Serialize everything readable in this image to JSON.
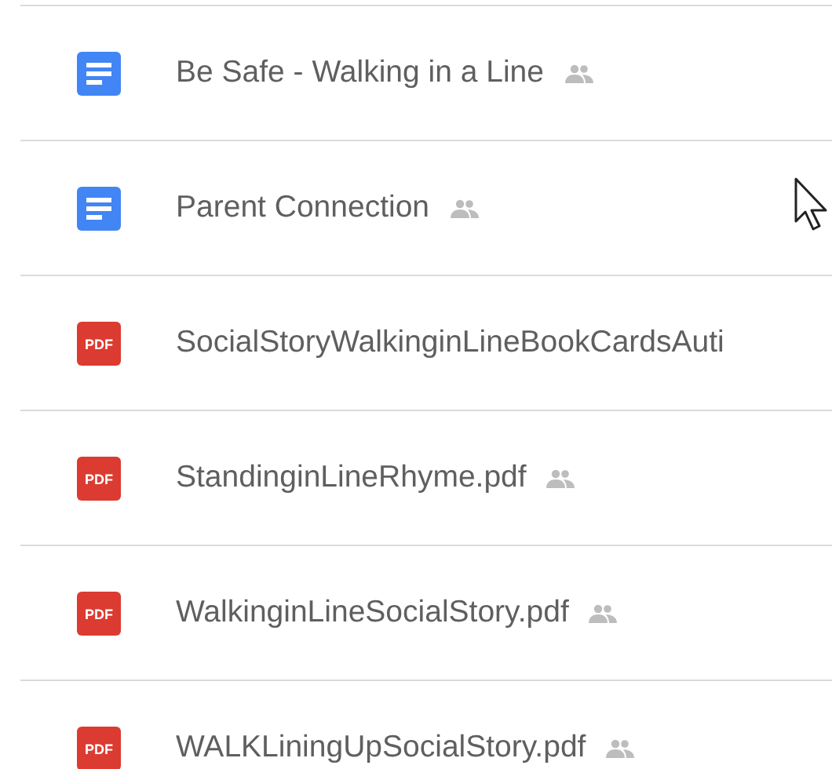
{
  "files": [
    {
      "name": "Be Safe - Walking in a Line",
      "kind": "doc",
      "shared": true
    },
    {
      "name": "Parent Connection",
      "kind": "doc",
      "shared": true
    },
    {
      "name": "SocialStoryWalkinginLineBookCardsAuti",
      "kind": "pdf",
      "badge": "PDF",
      "shared": false
    },
    {
      "name": "StandinginLineRhyme.pdf",
      "kind": "pdf",
      "badge": "PDF",
      "shared": true
    },
    {
      "name": "WalkinginLineSocialStory.pdf",
      "kind": "pdf",
      "badge": "PDF",
      "shared": true
    },
    {
      "name": "WALKLiningUpSocialStory.pdf",
      "kind": "pdf",
      "badge": "PDF",
      "shared": true
    }
  ]
}
